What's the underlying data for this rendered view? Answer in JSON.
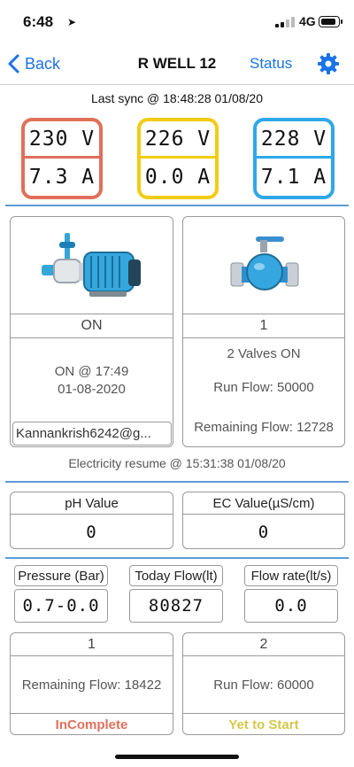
{
  "status_bar": {
    "time": "6:48",
    "network": "4G"
  },
  "nav": {
    "back_label": "Back",
    "title": "R WELL 12",
    "status_label": "Status"
  },
  "sync_text": "Last sync @ 18:48:28  01/08/20",
  "phases": [
    {
      "voltage": "230 V",
      "current": "7.3 A",
      "color": "#e0705a"
    },
    {
      "voltage": "226 V",
      "current": "0.0 A",
      "color": "#f2cc12"
    },
    {
      "voltage": "228 V",
      "current": "7.1 A",
      "color": "#2ea8e8"
    }
  ],
  "motor": {
    "state": "ON",
    "time_line": "ON @ 17:49",
    "date_line": "01-08-2020",
    "user": "Kannankrish6242@g..."
  },
  "valve": {
    "count": "1",
    "valves_on": "2 Valves ON",
    "run_flow": "Run Flow: 50000",
    "remaining_flow": "Remaining Flow: 12728"
  },
  "electricity_resume": "Electricity resume @ 15:31:38 01/08/20",
  "sensors": {
    "ph": {
      "label": "pH Value",
      "value": "0"
    },
    "ec": {
      "label": "EC Value(µS/cm)",
      "value": "0"
    }
  },
  "metrics": {
    "pressure": {
      "label": "Pressure (Bar)",
      "value": "0.7-0.0"
    },
    "today_flow": {
      "label": "Today Flow(lt)",
      "value": "80827"
    },
    "flow_rate": {
      "label": "Flow rate(lt/s)",
      "value": "0.0"
    }
  },
  "zones": [
    {
      "number": "1",
      "flow": "Remaining Flow: 18422",
      "status": "InComplete",
      "status_color": "#e0705a"
    },
    {
      "number": "2",
      "flow": "Run Flow: 60000",
      "status": "Yet to Start",
      "status_color": "#d4c84a"
    }
  ],
  "icons": [
    "location-arrow-icon",
    "signal-icon",
    "battery-icon",
    "chevron-left-icon",
    "gear-icon",
    "motor-pump-icon",
    "valve-icon"
  ]
}
